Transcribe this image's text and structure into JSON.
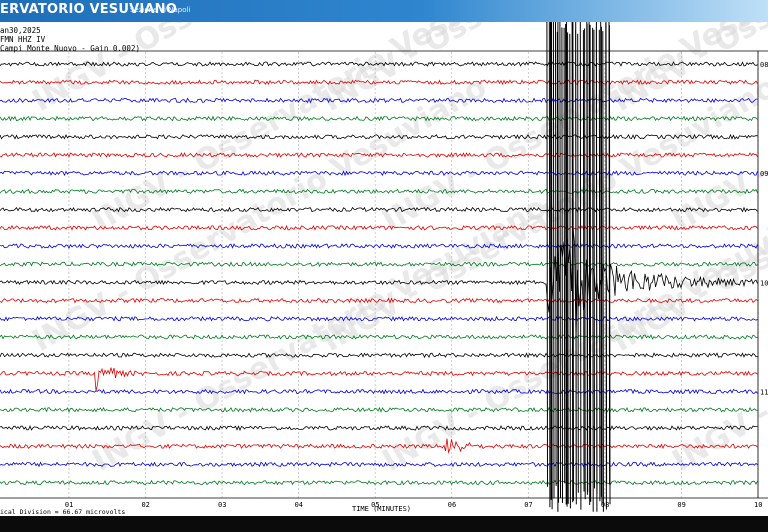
{
  "header": {
    "title": "ERVATORIO VESUVIANO",
    "subtitle": "Sezione di Napoli"
  },
  "station": {
    "date": "an30,2025",
    "channel": "FMN HHZ IV",
    "site_gain": "Campi Monte Nuovo  - Gain 0.002)"
  },
  "footer": {
    "scale_text": "ical Division =   66.67 microvolts"
  },
  "colors": {
    "header_bg": "#2f86cf",
    "trace_black": "#000000",
    "trace_red": "#e00000",
    "trace_blue": "#0000dd",
    "trace_green": "#007a1f",
    "watermark": "#d8d8d8"
  },
  "watermark": "INGV - Osservatorio Vesuviano",
  "chart_data": {
    "type": "line",
    "title": "",
    "xlabel": "TIME (MINUTES)",
    "ylabel": "",
    "x_ticks": [
      "01",
      "02",
      "03",
      "04",
      "05",
      "06",
      "07",
      "08",
      "09",
      "10"
    ],
    "xlim": [
      0.1,
      10
    ],
    "grid": true,
    "hour_labels": [
      {
        "label": "08",
        "trace": 0
      },
      {
        "label": "09",
        "trace": 6
      },
      {
        "label": "10",
        "trace": 12
      },
      {
        "label": "11",
        "trace": 18
      }
    ],
    "color_cycle": [
      "black",
      "red",
      "blue",
      "green"
    ],
    "trace_count": 24,
    "series": [
      {
        "trace": 12,
        "event_start_min": 7.25,
        "event_peak_min": 7.4,
        "coda_end_min": 10.0
      },
      {
        "trace": 17,
        "event_start_min": 1.35,
        "event_peak_min": 1.4
      },
      {
        "trace": 21,
        "event_start_min": 5.9,
        "event_peak_min": 5.95
      }
    ]
  }
}
